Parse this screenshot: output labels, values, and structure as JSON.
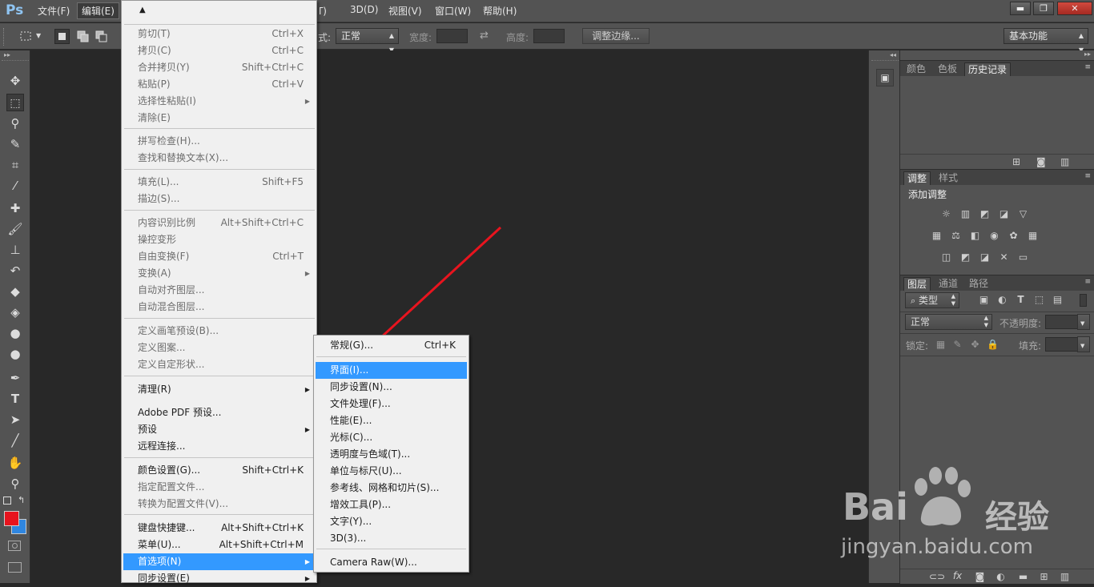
{
  "app": {
    "logo": "Ps"
  },
  "menubar": {
    "items": [
      {
        "label": "文件(F)"
      },
      {
        "label": "编辑(E)"
      },
      {
        "label": "镜(T)"
      },
      {
        "label": "3D(D)"
      },
      {
        "label": "视图(V)"
      },
      {
        "label": "窗口(W)"
      },
      {
        "label": "帮助(H)"
      }
    ]
  },
  "window_controls": {
    "minimize": "▬",
    "restore": "❐",
    "close": "✕"
  },
  "options_bar": {
    "style_label": "式:",
    "style_value": "正常",
    "width_label": "宽度:",
    "height_label": "高度:",
    "refine_edge_button": "调整边缘...",
    "workspace_value": "基本功能"
  },
  "edit_menu": {
    "scroll_up": "▲",
    "items": [
      {
        "label": "剪切(T)",
        "shortcut": "Ctrl+X",
        "disabled": true
      },
      {
        "label": "拷贝(C)",
        "shortcut": "Ctrl+C",
        "disabled": true
      },
      {
        "label": "合并拷贝(Y)",
        "shortcut": "Shift+Ctrl+C",
        "disabled": true
      },
      {
        "label": "粘贴(P)",
        "shortcut": "Ctrl+V",
        "disabled": true
      },
      {
        "label": "选择性粘贴(I)",
        "shortcut": "",
        "disabled": true,
        "submenu": true
      },
      {
        "label": "清除(E)",
        "shortcut": "",
        "disabled": true
      },
      {
        "label": "拼写检查(H)...",
        "shortcut": "",
        "disabled": true
      },
      {
        "label": "查找和替换文本(X)...",
        "shortcut": "",
        "disabled": true
      },
      {
        "label": "填充(L)...",
        "shortcut": "Shift+F5",
        "disabled": true
      },
      {
        "label": "描边(S)...",
        "shortcut": "",
        "disabled": true
      },
      {
        "label": "内容识别比例",
        "shortcut": "Alt+Shift+Ctrl+C",
        "disabled": true
      },
      {
        "label": "操控变形",
        "shortcut": "",
        "disabled": true
      },
      {
        "label": "自由变换(F)",
        "shortcut": "Ctrl+T",
        "disabled": true
      },
      {
        "label": "变换(A)",
        "shortcut": "",
        "disabled": true,
        "submenu": true
      },
      {
        "label": "自动对齐图层...",
        "shortcut": "",
        "disabled": true
      },
      {
        "label": "自动混合图层...",
        "shortcut": "",
        "disabled": true
      },
      {
        "label": "定义画笔预设(B)...",
        "shortcut": "",
        "disabled": true
      },
      {
        "label": "定义图案...",
        "shortcut": "",
        "disabled": true
      },
      {
        "label": "定义自定形状...",
        "shortcut": "",
        "disabled": true
      },
      {
        "label": "清理(R)",
        "shortcut": "",
        "disabled": false,
        "submenu": true
      },
      {
        "label": "Adobe PDF 预设...",
        "shortcut": "",
        "disabled": false
      },
      {
        "label": "预设",
        "shortcut": "",
        "disabled": false,
        "submenu": true
      },
      {
        "label": "远程连接...",
        "shortcut": "",
        "disabled": false
      },
      {
        "label": "颜色设置(G)...",
        "shortcut": "Shift+Ctrl+K",
        "disabled": false
      },
      {
        "label": "指定配置文件...",
        "shortcut": "",
        "disabled": true
      },
      {
        "label": "转换为配置文件(V)...",
        "shortcut": "",
        "disabled": true
      },
      {
        "label": "键盘快捷键...",
        "shortcut": "Alt+Shift+Ctrl+K",
        "disabled": false
      },
      {
        "label": "菜单(U)...",
        "shortcut": "Alt+Shift+Ctrl+M",
        "disabled": false
      },
      {
        "label": "首选项(N)",
        "shortcut": "",
        "disabled": false,
        "submenu": true,
        "highlighted": true
      },
      {
        "label": "同步设置(E)",
        "shortcut": "",
        "disabled": false,
        "submenu": true
      }
    ]
  },
  "prefs_submenu": {
    "items": [
      {
        "label": "常规(G)...",
        "shortcut": "Ctrl+K"
      },
      {
        "label": "界面(I)...",
        "shortcut": "",
        "highlighted": true
      },
      {
        "label": "同步设置(N)...",
        "shortcut": ""
      },
      {
        "label": "文件处理(F)...",
        "shortcut": ""
      },
      {
        "label": "性能(E)...",
        "shortcut": ""
      },
      {
        "label": "光标(C)...",
        "shortcut": ""
      },
      {
        "label": "透明度与色域(T)...",
        "shortcut": ""
      },
      {
        "label": "单位与标尺(U)...",
        "shortcut": ""
      },
      {
        "label": "参考线、网格和切片(S)...",
        "shortcut": ""
      },
      {
        "label": "增效工具(P)...",
        "shortcut": ""
      },
      {
        "label": "文字(Y)...",
        "shortcut": ""
      },
      {
        "label": "3D(3)...",
        "shortcut": ""
      },
      {
        "label": "Camera Raw(W)...",
        "shortcut": ""
      }
    ]
  },
  "panels": {
    "history": {
      "tabs": [
        "颜色",
        "色板",
        "历史记录"
      ]
    },
    "adjustments": {
      "tabs": [
        "调整",
        "样式"
      ],
      "title": "添加调整"
    },
    "layers": {
      "tabs": [
        "图层",
        "通道",
        "路径"
      ],
      "filter_kind": "类型",
      "blend_mode": "正常",
      "opacity_label": "不透明度:",
      "lock_label": "锁定:",
      "fill_label": "填充:"
    }
  },
  "watermark": {
    "brand": "Bai",
    "brand2": "经验",
    "url": "jingyan.baidu.com"
  },
  "colors": {
    "accent": "#3399ff",
    "foreground": "#e8141e",
    "background": "#2f86e0",
    "arrow": "#e8141e"
  }
}
